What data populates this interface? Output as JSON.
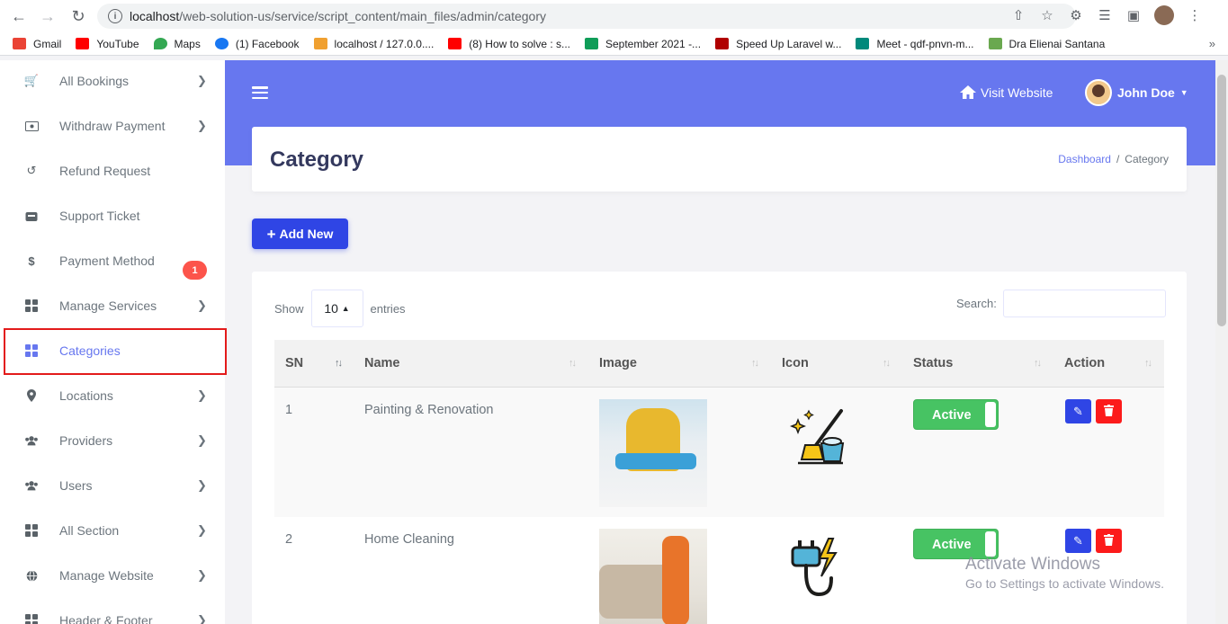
{
  "browser": {
    "url_host": "localhost",
    "url_path": "/web-solution-us/service/script_content/main_files/admin/category",
    "bookmarks": [
      {
        "label": "Gmail",
        "color": "#ea4335"
      },
      {
        "label": "YouTube",
        "color": "#ff0000"
      },
      {
        "label": "Maps",
        "color": "#34a853"
      },
      {
        "label": "(1) Facebook",
        "color": "#1877f2"
      },
      {
        "label": "localhost / 127.0.0....",
        "color": "#f0a030"
      },
      {
        "label": "(8) How to solve : s...",
        "color": "#ff0000"
      },
      {
        "label": "September 2021 -...",
        "color": "#0f9d58"
      },
      {
        "label": "Speed Up Laravel w...",
        "color": "#b00000"
      },
      {
        "label": "Meet - qdf-pnvn-m...",
        "color": "#00897b"
      },
      {
        "label": "Dra Elienai Santana",
        "color": "#6aa84f"
      }
    ],
    "more": "»"
  },
  "sidebar": {
    "items": [
      {
        "label": "All Bookings",
        "icon": "cart-icon"
      },
      {
        "label": "Withdraw Payment",
        "icon": "money-icon"
      },
      {
        "label": "Refund Request",
        "icon": "undo-icon"
      },
      {
        "label": "Support Ticket",
        "icon": "ticket-icon",
        "badge": "1"
      },
      {
        "label": "Payment Method",
        "icon": "dollar-icon"
      },
      {
        "label": "Manage Services",
        "icon": "grid-icon"
      },
      {
        "label": "Categories",
        "icon": "grid-icon"
      },
      {
        "label": "Locations",
        "icon": "map-pin-icon"
      },
      {
        "label": "Providers",
        "icon": "users-icon"
      },
      {
        "label": "Users",
        "icon": "users-icon"
      },
      {
        "label": "All Section",
        "icon": "grid-icon"
      },
      {
        "label": "Manage Website",
        "icon": "globe-icon"
      },
      {
        "label": "Header & Footer",
        "icon": "grid-icon"
      }
    ]
  },
  "header": {
    "visit_website": "Visit Website",
    "user_name": "John Doe"
  },
  "page": {
    "title": "Category",
    "breadcrumb_home": "Dashboard",
    "breadcrumb_sep": "/",
    "breadcrumb_current": "Category"
  },
  "toolbar": {
    "add_new": "Add New"
  },
  "table": {
    "show_label": "Show",
    "entries_value": "10",
    "entries_label": "entries",
    "search_label": "Search:",
    "columns": [
      "SN",
      "Name",
      "Image",
      "Icon",
      "Status",
      "Action"
    ],
    "rows": [
      {
        "sn": "1",
        "name": "Painting & Renovation",
        "status": "Active"
      },
      {
        "sn": "2",
        "name": "Home Cleaning",
        "status": "Active"
      }
    ]
  },
  "watermark": {
    "line1": "Activate Windows",
    "line2": "Go to Settings to activate Windows."
  },
  "colors": {
    "accent": "#6777ef",
    "button": "#2f45e5",
    "active_status": "#47c363",
    "delete": "#fc1b1b"
  }
}
